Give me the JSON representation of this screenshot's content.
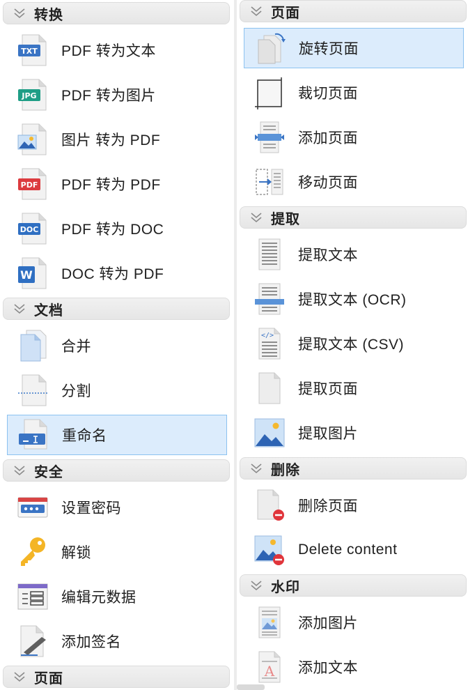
{
  "left_column": {
    "sections": [
      {
        "title": "转换",
        "items": [
          {
            "label": "PDF 转为文本",
            "icon": "txt-file-icon"
          },
          {
            "label": "PDF 转为图片",
            "icon": "jpg-file-icon"
          },
          {
            "label": "图片 转为 PDF",
            "icon": "image-file-icon"
          },
          {
            "label": "PDF 转为 PDF",
            "icon": "pdf-file-icon"
          },
          {
            "label": "PDF 转为 DOC",
            "icon": "doc-file-icon"
          },
          {
            "label": "DOC 转为 PDF",
            "icon": "word-file-icon"
          }
        ]
      },
      {
        "title": "文档",
        "items": [
          {
            "label": "合并",
            "icon": "merge-icon"
          },
          {
            "label": "分割",
            "icon": "split-icon"
          },
          {
            "label": "重命名",
            "icon": "rename-icon",
            "selected": true
          }
        ]
      },
      {
        "title": "安全",
        "items": [
          {
            "label": "设置密码",
            "icon": "password-icon"
          },
          {
            "label": "解锁",
            "icon": "key-icon"
          },
          {
            "label": "编辑元数据",
            "icon": "metadata-icon"
          },
          {
            "label": "添加签名",
            "icon": "signature-icon"
          }
        ]
      },
      {
        "title": "页面",
        "items": []
      }
    ]
  },
  "right_column": {
    "sections": [
      {
        "title": "页面",
        "items": [
          {
            "label": "旋转页面",
            "icon": "rotate-page-icon",
            "selected": true
          },
          {
            "label": "裁切页面",
            "icon": "crop-page-icon"
          },
          {
            "label": "添加页面",
            "icon": "add-page-icon"
          },
          {
            "label": "移动页面",
            "icon": "move-page-icon"
          }
        ]
      },
      {
        "title": "提取",
        "items": [
          {
            "label": "提取文本",
            "icon": "extract-text-icon"
          },
          {
            "label": "提取文本 (OCR)",
            "icon": "extract-ocr-icon"
          },
          {
            "label": "提取文本 (CSV)",
            "icon": "extract-csv-icon"
          },
          {
            "label": "提取页面",
            "icon": "extract-page-icon"
          },
          {
            "label": "提取图片",
            "icon": "extract-image-icon"
          }
        ]
      },
      {
        "title": "删除",
        "items": [
          {
            "label": "删除页面",
            "icon": "delete-page-icon"
          },
          {
            "label": "Delete content",
            "icon": "delete-content-icon"
          }
        ]
      },
      {
        "title": "水印",
        "items": [
          {
            "label": "添加图片",
            "icon": "watermark-image-icon"
          },
          {
            "label": "添加文本",
            "icon": "watermark-text-icon"
          }
        ]
      }
    ]
  },
  "colors": {
    "selection_bg": "#dcecfc",
    "selection_border": "#8cc2f0",
    "header_bg": "#e9e9e9",
    "accent_blue": "#2f7fd8",
    "accent_red": "#e0353b"
  }
}
